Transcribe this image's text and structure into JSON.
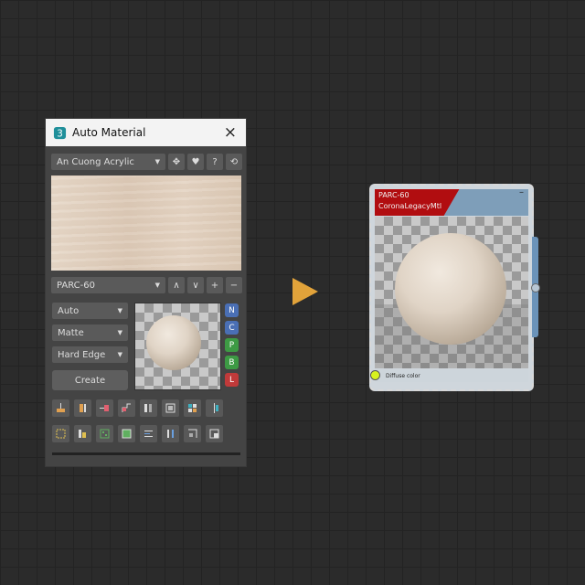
{
  "panel": {
    "title": "Auto Material",
    "close_icon": "×",
    "library_value": "An Cuong Acrylic",
    "library_buttons": [
      "✥",
      "♥",
      "?",
      "⟲"
    ],
    "code_value": "PARC-60",
    "code_buttons": [
      "∧",
      "∨",
      "+",
      "−"
    ],
    "mapping_value": "Auto",
    "finish_value": "Matte",
    "edge_value": "Hard Edge",
    "create_label": "Create",
    "channels": [
      {
        "label": "N",
        "color": "#4a6fb5"
      },
      {
        "label": "C",
        "color": "#4a6fb5"
      },
      {
        "label": "P",
        "color": "#3d9a44"
      },
      {
        "label": "B",
        "color": "#3d9a44"
      },
      {
        "label": "L",
        "color": "#c03a3a"
      }
    ]
  },
  "node": {
    "name": "PARC-60",
    "type": "CoronaLegacyMtl",
    "minimize": "–",
    "input_label": "Diffuse color"
  }
}
